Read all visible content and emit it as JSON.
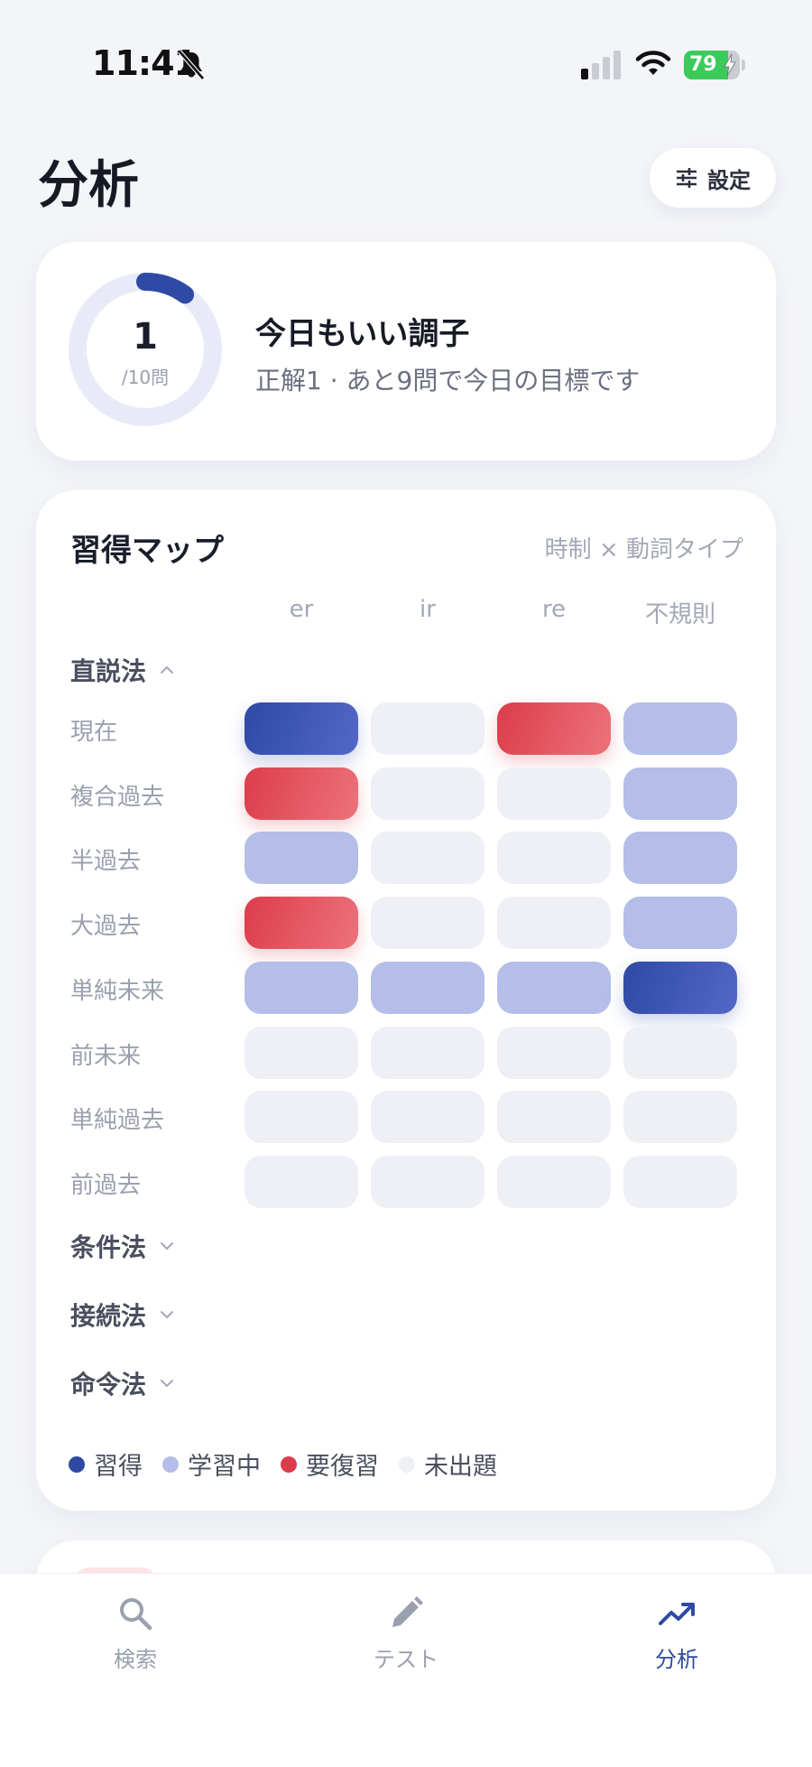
{
  "status_bar": {
    "time": "11:41",
    "battery_percent": 79,
    "battery_label": "79"
  },
  "header": {
    "title": "分析",
    "settings_label": "設定"
  },
  "daily_progress": {
    "correct": 1,
    "goal": 10,
    "number_label": "1",
    "goal_label": "/10問",
    "heading": "今日もいい調子",
    "description": "正解1 · あと9問で今日の目標です",
    "colors": {
      "ring_track": "#e8ebf7",
      "ring_fill": "#2e4aa4"
    }
  },
  "mastery_map": {
    "title": "習得マップ",
    "subtitle": "時制 × 動詞タイプ",
    "columns": [
      "er",
      "ir",
      "re",
      "不規則"
    ],
    "sections": [
      {
        "name": "直説法",
        "expanded": true,
        "rows": [
          {
            "label": "現在",
            "cells": [
              "mastered",
              "unseen",
              "review",
              "learning"
            ]
          },
          {
            "label": "複合過去",
            "cells": [
              "review",
              "unseen",
              "unseen",
              "learning"
            ]
          },
          {
            "label": "半過去",
            "cells": [
              "learning",
              "unseen",
              "unseen",
              "learning"
            ]
          },
          {
            "label": "大過去",
            "cells": [
              "review",
              "unseen",
              "unseen",
              "learning"
            ]
          },
          {
            "label": "単純未来",
            "cells": [
              "learning",
              "learning",
              "learning",
              "mastered"
            ]
          },
          {
            "label": "前未来",
            "cells": [
              "unseen",
              "unseen",
              "unseen",
              "unseen"
            ]
          },
          {
            "label": "単純過去",
            "cells": [
              "unseen",
              "unseen",
              "unseen",
              "unseen"
            ]
          },
          {
            "label": "前過去",
            "cells": [
              "unseen",
              "unseen",
              "unseen",
              "unseen"
            ]
          }
        ]
      },
      {
        "name": "条件法",
        "expanded": false,
        "rows": []
      },
      {
        "name": "接続法",
        "expanded": false,
        "rows": []
      },
      {
        "name": "命令法",
        "expanded": false,
        "rows": []
      }
    ],
    "legend": [
      {
        "key": "mastered",
        "label": "習得",
        "color": "#2e4aa4"
      },
      {
        "key": "learning",
        "label": "学習中",
        "color": "#b4bee8"
      },
      {
        "key": "review",
        "label": "要復習",
        "color": "#dc3c4b"
      },
      {
        "key": "unseen",
        "label": "未出題",
        "color": "#eff0f5"
      }
    ]
  },
  "tab_bar": {
    "tabs": [
      {
        "id": "search",
        "label": "検索",
        "icon": "search-icon",
        "active": false
      },
      {
        "id": "test",
        "label": "テスト",
        "icon": "pencil-icon",
        "active": false
      },
      {
        "id": "analysis",
        "label": "分析",
        "icon": "trending-up-icon",
        "active": true
      }
    ],
    "active_color": "#2e4aa4",
    "inactive_color": "#9aa0ae"
  }
}
